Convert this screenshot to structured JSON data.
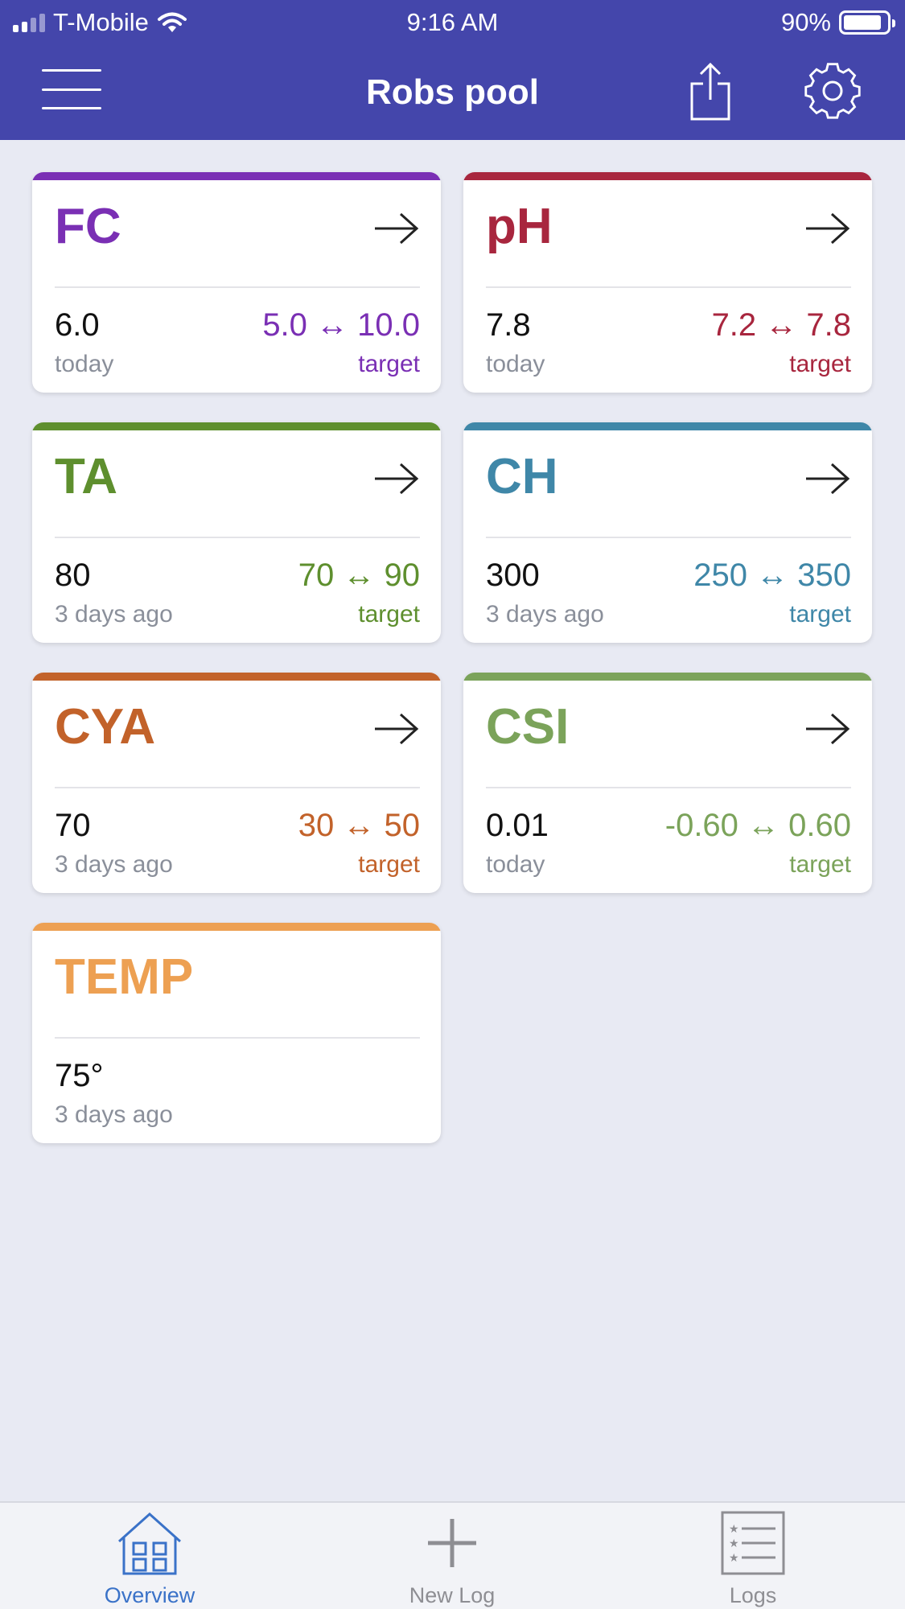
{
  "status_bar": {
    "carrier": "T-Mobile",
    "time": "9:16 AM",
    "battery": "90%"
  },
  "nav": {
    "title": "Robs pool",
    "menu_icon": "hamburger-menu-icon",
    "share_icon": "share-icon",
    "settings_icon": "gear-icon"
  },
  "cards": [
    {
      "name": "FC",
      "value": "6.0",
      "when": "today",
      "range": "5.0 ↔ 10.0",
      "target_label": "target",
      "color": "#7a2fb4",
      "has_arrow": true
    },
    {
      "name": "pH",
      "value": "7.8",
      "when": "today",
      "range": "7.2 ↔ 7.8",
      "target_label": "target",
      "color": "#a8263e",
      "has_arrow": true
    },
    {
      "name": "TA",
      "value": "80",
      "when": "3 days ago",
      "range": "70 ↔ 90",
      "target_label": "target",
      "color": "#5e8f2e",
      "has_arrow": true
    },
    {
      "name": "CH",
      "value": "300",
      "when": "3 days ago",
      "range": "250 ↔ 350",
      "target_label": "target",
      "color": "#3f87a8",
      "has_arrow": true
    },
    {
      "name": "CYA",
      "value": "70",
      "when": "3 days ago",
      "range": "30 ↔ 50",
      "target_label": "target",
      "color": "#c2622a",
      "has_arrow": true
    },
    {
      "name": "CSI",
      "value": "0.01",
      "when": "today",
      "range": "-0.60 ↔ 0.60",
      "target_label": "target",
      "color": "#7ba35a",
      "has_arrow": true
    },
    {
      "name": "TEMP",
      "value": "75°",
      "when": "3 days ago",
      "range": "",
      "target_label": "",
      "color": "#eda052",
      "has_arrow": false
    }
  ],
  "tabs": [
    {
      "label": "Overview",
      "icon": "house-icon",
      "active": true
    },
    {
      "label": "New Log",
      "icon": "plus-icon",
      "active": false
    },
    {
      "label": "Logs",
      "icon": "list-icon",
      "active": false
    }
  ],
  "colors": {
    "header": "#4446ab",
    "background": "#e8eaf3",
    "tab_active": "#3a72c8",
    "tab_inactive": "#8e8e93"
  }
}
